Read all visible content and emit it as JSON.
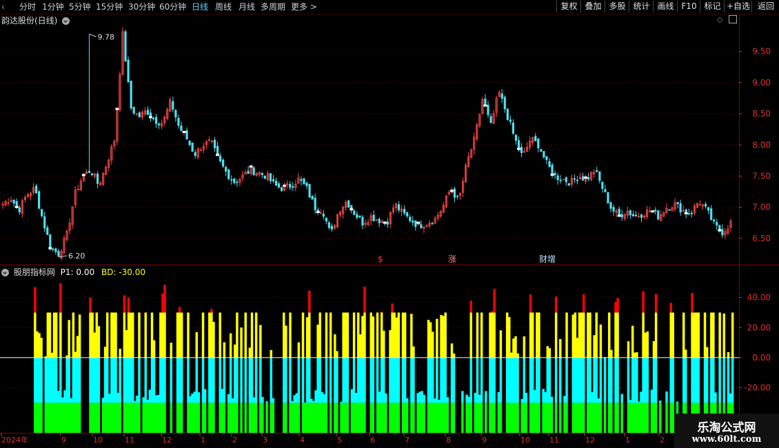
{
  "periods": [
    {
      "label": "分时",
      "active": false
    },
    {
      "label": "1分钟",
      "active": false
    },
    {
      "label": "5分钟",
      "active": false
    },
    {
      "label": "15分钟",
      "active": false
    },
    {
      "label": "30分钟",
      "active": false
    },
    {
      "label": "60分钟",
      "active": false
    },
    {
      "label": "日线",
      "active": true
    },
    {
      "label": "周线",
      "active": false
    },
    {
      "label": "月线",
      "active": false
    },
    {
      "label": "多周期",
      "active": false
    },
    {
      "label": "更多 >",
      "active": false
    }
  ],
  "tools": [
    "复权",
    "叠加",
    "多股",
    "统计",
    "画线",
    "F10",
    "标记",
    "+自选",
    "返回"
  ],
  "main_panel": {
    "title": "韵达股份(日线)",
    "high_label": "9.78",
    "low_label": "6.20",
    "y_ticks": [
      "9.50",
      "9.00",
      "8.50",
      "8.00",
      "7.50",
      "7.00",
      "6.50"
    ],
    "markers": [
      {
        "text": "$",
        "color": "#ff3030"
      },
      {
        "text": "涨",
        "color": "#ff8080"
      },
      {
        "text": "财增",
        "color": "#bfe0ff"
      }
    ]
  },
  "indicator_panel": {
    "title": "股朋指标网",
    "p1_label": "P1: 0.00",
    "bd_label": "BD: -30.00",
    "y_ticks": [
      "40.00",
      "20.00",
      "0.00",
      "-20.00"
    ]
  },
  "x_axis": {
    "labels": [
      "2024年",
      "9",
      "10",
      "11",
      "12",
      "1",
      "2",
      "3",
      "4",
      "5",
      "6",
      "7",
      "8",
      "9",
      "10",
      "11",
      "12",
      "1",
      "2"
    ]
  },
  "watermark": {
    "name": "乐淘公式网",
    "url": "www.60lt.com"
  },
  "colors": {
    "up": "#ff4a4a",
    "down": "#4fe0f0",
    "red_band": "#ff0000",
    "yellow_band": "#ffff00",
    "cyan_band": "#00ffff",
    "green_band": "#00ff00",
    "grid": "#6a0000",
    "axis_text": "#e03030"
  },
  "chart_data": [
    {
      "type": "candlestick",
      "title": "韵达股份(日线)",
      "ylim": [
        6.1,
        9.95
      ],
      "x": [
        "2024-08",
        "2024-09",
        "2024-10",
        "2024-11",
        "2024-12",
        "2025-01",
        "2025-02",
        "2025-03",
        "2025-04",
        "2025-05",
        "2025-06",
        "2025-07",
        "2025-08",
        "2025-09",
        "2025-10",
        "2025-11",
        "2025-12",
        "2026-01",
        "2026-02"
      ],
      "close_path": [
        7.05,
        7.15,
        6.95,
        7.2,
        7.3,
        6.8,
        6.35,
        6.25,
        6.55,
        7.2,
        7.5,
        7.6,
        7.35,
        7.7,
        8.1,
        9.78,
        8.6,
        8.45,
        8.55,
        8.4,
        8.35,
        8.7,
        8.3,
        8.1,
        7.85,
        8.0,
        8.05,
        7.75,
        7.55,
        7.4,
        7.5,
        7.6,
        7.55,
        7.5,
        7.35,
        7.3,
        7.35,
        7.45,
        7.3,
        7.0,
        6.95,
        6.55,
        6.95,
        7.1,
        6.9,
        6.75,
        6.85,
        6.8,
        6.75,
        7.05,
        6.9,
        6.8,
        6.7,
        6.75,
        6.8,
        7.0,
        7.3,
        7.1,
        7.7,
        8.1,
        8.75,
        8.3,
        8.85,
        8.5,
        8.1,
        7.8,
        8.1,
        8.0,
        7.7,
        7.5,
        7.45,
        7.4,
        7.5,
        7.45,
        7.6,
        7.3,
        7.0,
        6.85,
        6.95,
        6.85,
        6.9,
        6.95,
        6.85,
        7.0,
        7.05,
        6.95,
        6.9,
        7.1,
        6.95,
        6.7,
        6.6,
        6.75
      ],
      "high": 9.78,
      "low": 6.2
    },
    {
      "type": "area",
      "title": "股朋指标网",
      "ylim": [
        -50,
        60
      ],
      "bands": [
        {
          "name": "red",
          "from": 30,
          "to": 50
        },
        {
          "name": "yellow",
          "from": 0,
          "to": 30
        },
        {
          "name": "cyan",
          "from": -30,
          "to": 0
        },
        {
          "name": "green",
          "from": -50,
          "to": -30
        }
      ],
      "p1": 0.0,
      "bd": -30.0
    }
  ]
}
